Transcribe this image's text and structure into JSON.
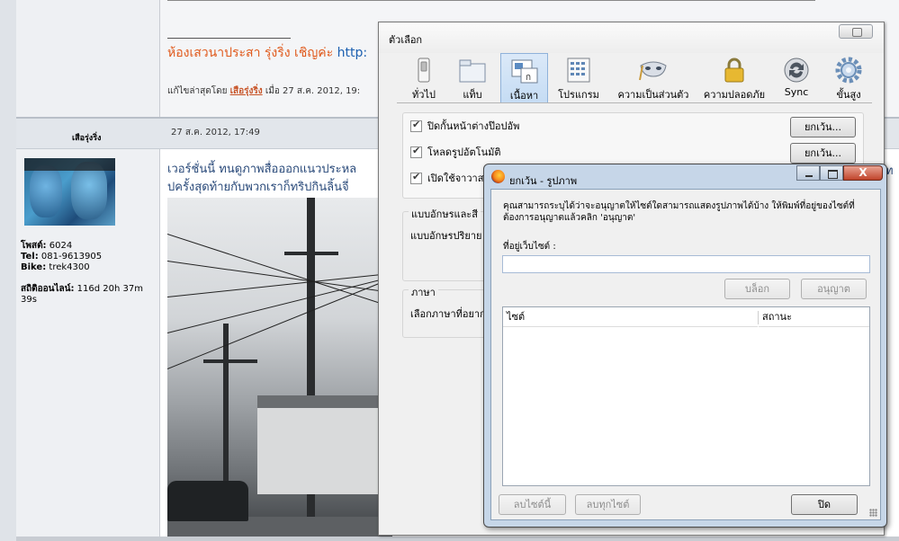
{
  "forum": {
    "signature_text": "ห้องเสวนาประสา รุ่งริ่ง เชิญค่ะ ",
    "signature_link": "http:",
    "edited_prefix": "แก้ไขล่าสุดโดย ",
    "edited_user": "เสือรุ่งริ่ง",
    "edited_suffix": " เมื่อ 27 ส.ค. 2012, 19:",
    "poster_name": "เสือรุ่งริ่ง",
    "post_date": "27 ส.ค. 2012, 17:49",
    "posts_label": "โพสต์:",
    "posts_value": " 6024",
    "tel_label": "Tel:",
    "tel_value": " 081-9613905",
    "bike_label": "Bike:",
    "bike_value": " trek4300",
    "online_label": "สถิติออนไลน์:",
    "online_value": " 116d 20h 37m",
    "online_value2": "39s",
    "body_line1": "เวอร์ชั่นนี้ ทนดูภาพสื่อออกแนวประหล",
    "body_line2": "ปครั้งสุดท้ายกับพวกเราก็ทริปกินลิ้นจี่",
    "body_right_char": "ท"
  },
  "options": {
    "title": "ตัวเลือก",
    "toolbar": [
      {
        "label": "ทั่วไป",
        "icon": "general-switch-icon"
      },
      {
        "label": "แท็บ",
        "icon": "tabs-folder-icon"
      },
      {
        "label": "เนื้อหา",
        "icon": "content-page-icon",
        "selected": true
      },
      {
        "label": "โปรแกรม",
        "icon": "applications-list-icon"
      },
      {
        "label": "ความเป็นส่วนตัว",
        "icon": "privacy-mask-icon"
      },
      {
        "label": "ความปลอดภัย",
        "icon": "security-lock-icon"
      },
      {
        "label": "Sync",
        "icon": "sync-icon"
      },
      {
        "label": "ขั้นสูง",
        "icon": "advanced-gear-icon"
      }
    ],
    "block_popups_label": "ปิดกั้นหน้าต่างป๊อปอัพ",
    "load_images_label": "โหลดรูปอัตโนมัติ",
    "enable_js_label": "เปิดใช้จาวาส",
    "exceptions1_label": "ยกเว้น...",
    "exceptions2_label": "ยกเว้น...",
    "fonts_legend": "แบบอักษรและสี",
    "fonts_text": "แบบอักษรปริยาย",
    "language_legend": "ภาษา",
    "language_text": "เลือกภาษาที่อยาก"
  },
  "dialog": {
    "title": "ยกเว้น - รูปภาพ",
    "description": "คุณสามารถระบุได้ว่าจะอนุญาตให้ไซต์ใดสามารถแสดงรูปภาพได้บ้าง ให้พิมพ์ที่อยู่ของไซต์ที่ต้องการอนุญาตแล้วคลิก 'อนุญาต'",
    "site_label": "ที่อยู่เว็บไซต์ :",
    "site_value": "",
    "block_button": "บล็อก",
    "allow_button": "อนุญาต",
    "col_site": "ไซต์",
    "col_status": "สถานะ",
    "remove_site_button": "ลบไซต์นี้",
    "remove_all_button": "ลบทุกไซต์",
    "close_button": "ปิด",
    "close_x": "X"
  }
}
